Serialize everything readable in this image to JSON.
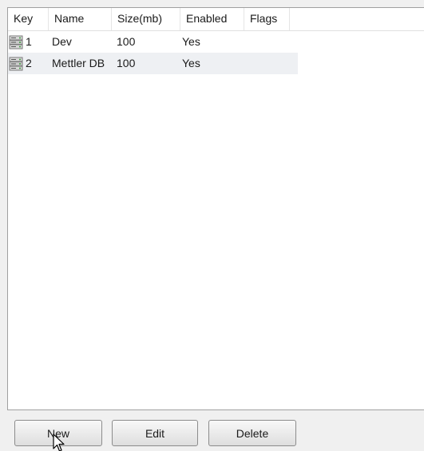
{
  "columns": {
    "key": "Key",
    "name": "Name",
    "size": "Size(mb)",
    "enabled": "Enabled",
    "flags": "Flags"
  },
  "rows": [
    {
      "key": "1",
      "name": "Dev",
      "size": "100",
      "enabled": "Yes",
      "flags": "",
      "icon": "database-icon"
    },
    {
      "key": "2",
      "name": "Mettler DB",
      "size": "100",
      "enabled": "Yes",
      "flags": "",
      "icon": "database-icon"
    }
  ],
  "buttons": {
    "new": "New",
    "edit": "Edit",
    "delete": "Delete"
  },
  "colors": {
    "window_bg": "#f0f0f0",
    "list_bg": "#ffffff",
    "alt_row_bg": "#eef0f3",
    "border": "#a0a0a0"
  }
}
